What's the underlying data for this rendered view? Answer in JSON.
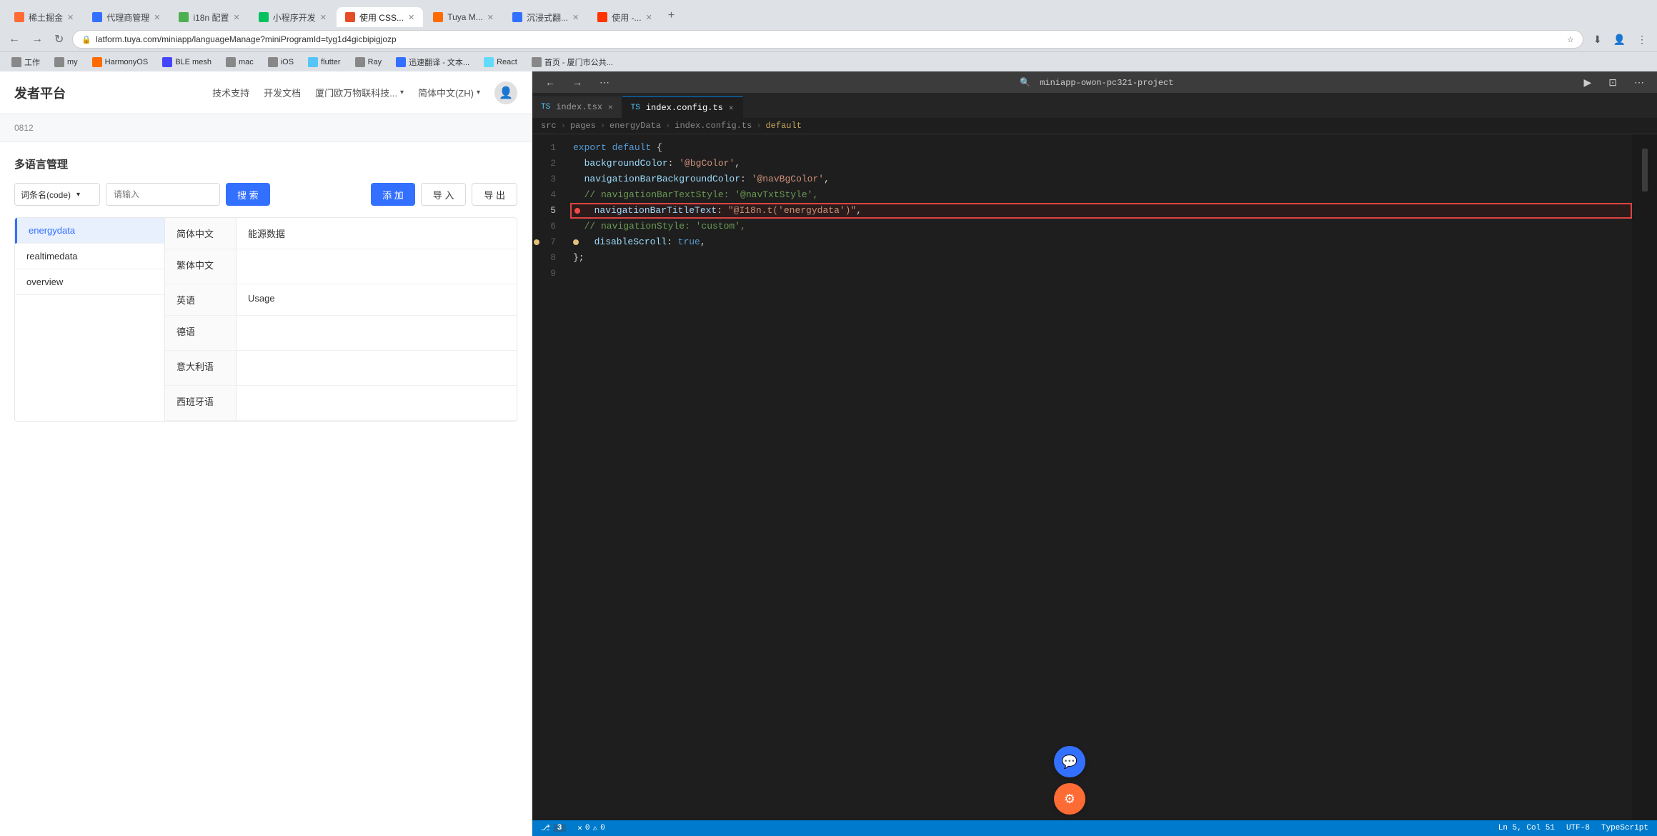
{
  "browser": {
    "tabs": [
      {
        "id": "tab1",
        "label": "稀土掘金",
        "favicon_color": "#ff6b35",
        "active": false
      },
      {
        "id": "tab2",
        "label": "代理商管理",
        "favicon_color": "#3370ff",
        "active": false
      },
      {
        "id": "tab3",
        "label": "i18n 配置",
        "favicon_color": "#4caf50",
        "active": false
      },
      {
        "id": "tab4",
        "label": "小程序开发",
        "favicon_color": "#07c160",
        "active": false
      },
      {
        "id": "tab5",
        "label": "使用 CSS...",
        "favicon_color": "#e44d26",
        "active": true
      },
      {
        "id": "tab6",
        "label": "Tuya M...",
        "favicon_color": "#ff6b00",
        "active": false
      },
      {
        "id": "tab7",
        "label": "沉浸式翻...",
        "favicon_color": "#3370ff",
        "active": false
      },
      {
        "id": "tab8",
        "label": "使用 -...",
        "favicon_color": "#ff3300",
        "active": false
      }
    ],
    "url": "latform.tuya.com/miniapp/languageManage?miniProgramId=tyg1d4gicbipigjozp",
    "bookmarks": [
      {
        "label": "工作",
        "icon_color": "#888"
      },
      {
        "label": "my",
        "icon_color": "#888"
      },
      {
        "label": "HarmonyOS",
        "icon_color": "#ff6b00"
      },
      {
        "label": "BLE mesh",
        "icon_color": "#888"
      },
      {
        "label": "mac",
        "icon_color": "#888"
      },
      {
        "label": "iOS",
        "icon_color": "#888"
      },
      {
        "label": "flutter",
        "icon_color": "#54c5f8"
      },
      {
        "label": "Ray",
        "icon_color": "#888"
      },
      {
        "label": "迅速翻译 - 文本...",
        "icon_color": "#888"
      },
      {
        "label": "React",
        "icon_color": "#61dafb"
      },
      {
        "label": "首页 - 厦门市公共...",
        "icon_color": "#888"
      }
    ]
  },
  "page": {
    "title": "发者平台",
    "subtitle": "0812",
    "header_links": [
      "技术支持",
      "开发文档"
    ],
    "company": "厦门欧万物联科技...",
    "lang_selector": "简体中文(ZH)"
  },
  "i18n_manager": {
    "title": "多语言管理",
    "filter": {
      "field_label": "词条名(code)",
      "placeholder": "请输入",
      "search_btn": "搜 索",
      "add_btn": "添 加",
      "import_btn": "导 入",
      "export_btn": "导 出"
    },
    "keys": [
      {
        "id": "energydata",
        "label": "energydata",
        "active": true
      },
      {
        "id": "realtimedata",
        "label": "realtimedata",
        "active": false
      },
      {
        "id": "overview",
        "label": "overview",
        "active": false
      }
    ],
    "languages": [
      {
        "lang": "简体中文",
        "value": "能源数据"
      },
      {
        "lang": "繁体中文",
        "value": ""
      },
      {
        "lang": "英语",
        "value": "Usage"
      },
      {
        "lang": "德语",
        "value": ""
      },
      {
        "lang": "意大利语",
        "value": ""
      },
      {
        "lang": "西班牙语",
        "value": ""
      }
    ]
  },
  "vscode": {
    "title": "miniapp-owon-pc321-project",
    "tabs": [
      {
        "label": "index.tsx",
        "active": false,
        "has_dot": false,
        "closeable": true
      },
      {
        "label": "index.config.ts",
        "active": true,
        "has_dot": false,
        "closeable": true
      }
    ],
    "breadcrumb": [
      "src",
      "pages",
      "energyData",
      "index.config.ts",
      "default"
    ],
    "lines": [
      {
        "num": 1,
        "tokens": [
          {
            "text": "export ",
            "cls": "kw"
          },
          {
            "text": "default",
            "cls": "kw"
          },
          {
            "text": " {",
            "cls": "punct"
          }
        ],
        "highlight": false
      },
      {
        "num": 2,
        "tokens": [
          {
            "text": "  backgroundColor: ",
            "cls": "prop"
          },
          {
            "text": "'@bgColor'",
            "cls": "str"
          },
          {
            "text": ",",
            "cls": "punct"
          }
        ],
        "highlight": false
      },
      {
        "num": 3,
        "tokens": [
          {
            "text": "  navigationBarBackgroundColor: ",
            "cls": "prop"
          },
          {
            "text": "'@navBgColor'",
            "cls": "str"
          },
          {
            "text": ",",
            "cls": "punct"
          }
        ],
        "highlight": false
      },
      {
        "num": 4,
        "tokens": [
          {
            "text": "  // navigationBarTextStyle: '@navTxtStyle',",
            "cls": "comment"
          }
        ],
        "highlight": false
      },
      {
        "num": 5,
        "tokens": [
          {
            "text": "  navigationBarTitleText: ",
            "cls": "prop"
          },
          {
            "text": "\"@I18n.t('energydata')\"",
            "cls": "str"
          },
          {
            "text": ",",
            "cls": "punct"
          }
        ],
        "highlight": true,
        "error": true
      },
      {
        "num": 6,
        "tokens": [
          {
            "text": "  // navigationStyle: 'custom',",
            "cls": "comment"
          }
        ],
        "highlight": false
      },
      {
        "num": 7,
        "tokens": [
          {
            "text": "  disableScroll: ",
            "cls": "prop"
          },
          {
            "text": "true",
            "cls": "bool"
          },
          {
            "text": ",",
            "cls": "punct"
          }
        ],
        "highlight": false,
        "has_dot": true
      },
      {
        "num": 8,
        "tokens": [
          {
            "text": "};",
            "cls": "punct"
          }
        ],
        "highlight": false
      },
      {
        "num": 9,
        "tokens": [],
        "highlight": false
      }
    ],
    "statusbar": {
      "branch": "3",
      "errors": "0",
      "warnings": "0",
      "lang": "TypeScript",
      "encoding": "UTF-8",
      "line_col": "Ln 5, Col 51"
    }
  },
  "floating": {
    "chat_icon": "💬",
    "other_icon": "⚙"
  }
}
